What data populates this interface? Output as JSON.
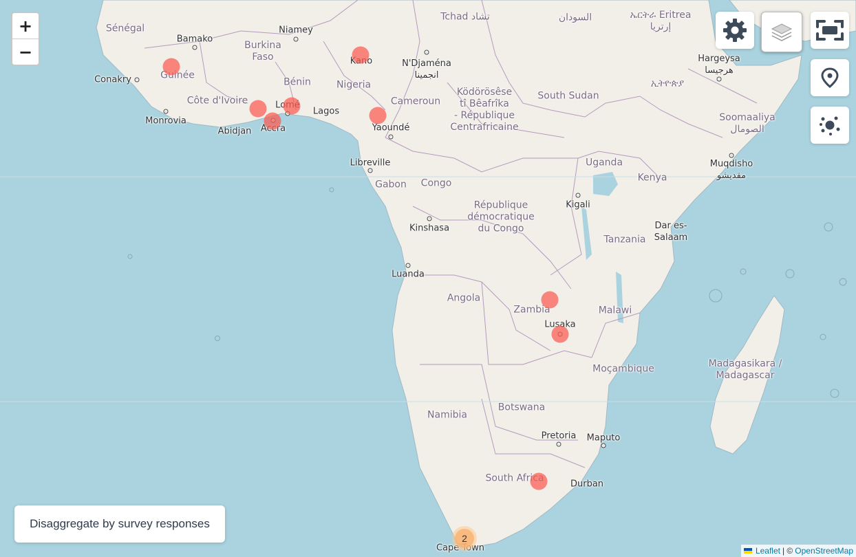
{
  "map": {
    "countries": [
      {
        "text": "Sénégal"
      },
      {
        "text": "Burkina\nFaso"
      },
      {
        "text": "Guinée"
      },
      {
        "text": "Côte d'Ivoire"
      },
      {
        "text": "Bénin"
      },
      {
        "text": "Nigeria"
      },
      {
        "text": "Tchad تشاد"
      },
      {
        "text": "السودان"
      },
      {
        "text": "ኤርትራ Eritrea\nإرتريا"
      },
      {
        "text": "Cameroun"
      },
      {
        "text": "Ködörösêse\ntî Bêafrîka\n- République\nCentrafricaine"
      },
      {
        "text": "South Sudan"
      },
      {
        "text": "ኢትዮጵያ"
      },
      {
        "text": "Soomaaliya\nالصومال"
      },
      {
        "text": "Gabon"
      },
      {
        "text": "Congo"
      },
      {
        "text": "Uganda"
      },
      {
        "text": "Kenya"
      },
      {
        "text": "République\ndémocratique\ndu Congo"
      },
      {
        "text": "Tanzania"
      },
      {
        "text": "Angola"
      },
      {
        "text": "Zambia"
      },
      {
        "text": "Malawi"
      },
      {
        "text": "Moçambique"
      },
      {
        "text": "Madagasikara /\nMadagascar"
      },
      {
        "text": "Namibia"
      },
      {
        "text": "Botswana"
      },
      {
        "text": "South Africa"
      }
    ],
    "cities": [
      {
        "text": "Bamako"
      },
      {
        "text": "Niamey"
      },
      {
        "text": "Conakry"
      },
      {
        "text": "Monrovia"
      },
      {
        "text": "Abidjan"
      },
      {
        "text": "Accra"
      },
      {
        "text": "Lomé"
      },
      {
        "text": "Lagos"
      },
      {
        "text": "Kano"
      },
      {
        "text": "N'Djaména\nانجمينا"
      },
      {
        "text": "Yaoundé"
      },
      {
        "text": "Libreville"
      },
      {
        "text": "Kinshasa"
      },
      {
        "text": "Kigali"
      },
      {
        "text": "Hargeysa\nهرجيسا"
      },
      {
        "text": "Muqdisho\nمقديشو"
      },
      {
        "text": "Dar es-\nSalaam"
      },
      {
        "text": "Luanda"
      },
      {
        "text": "Lusaka"
      },
      {
        "text": "Pretoria"
      },
      {
        "text": "Maputo"
      },
      {
        "text": "Durban"
      },
      {
        "text": "Cape Town"
      }
    ],
    "marker_count": 11,
    "cluster": {
      "count": "2"
    }
  },
  "controls": {
    "zoom_in": "+",
    "zoom_out": "−",
    "settings_icon": "gear-icon",
    "layers_icon": "layers-icon",
    "fullscreen_icon": "fullscreen-icon",
    "heatmap_icon": "location-pin-icon",
    "cluster_icon": "cluster-icon"
  },
  "disaggregate_label": "Disaggregate by survey responses",
  "attribution": {
    "leaflet": "Leaflet",
    "separator": "| ©",
    "osm": "OpenStreetMap"
  },
  "colors": {
    "water": "#aad3df",
    "land": "#f2efe9",
    "marker": "#fa5a50",
    "border": "#b39bbd"
  }
}
